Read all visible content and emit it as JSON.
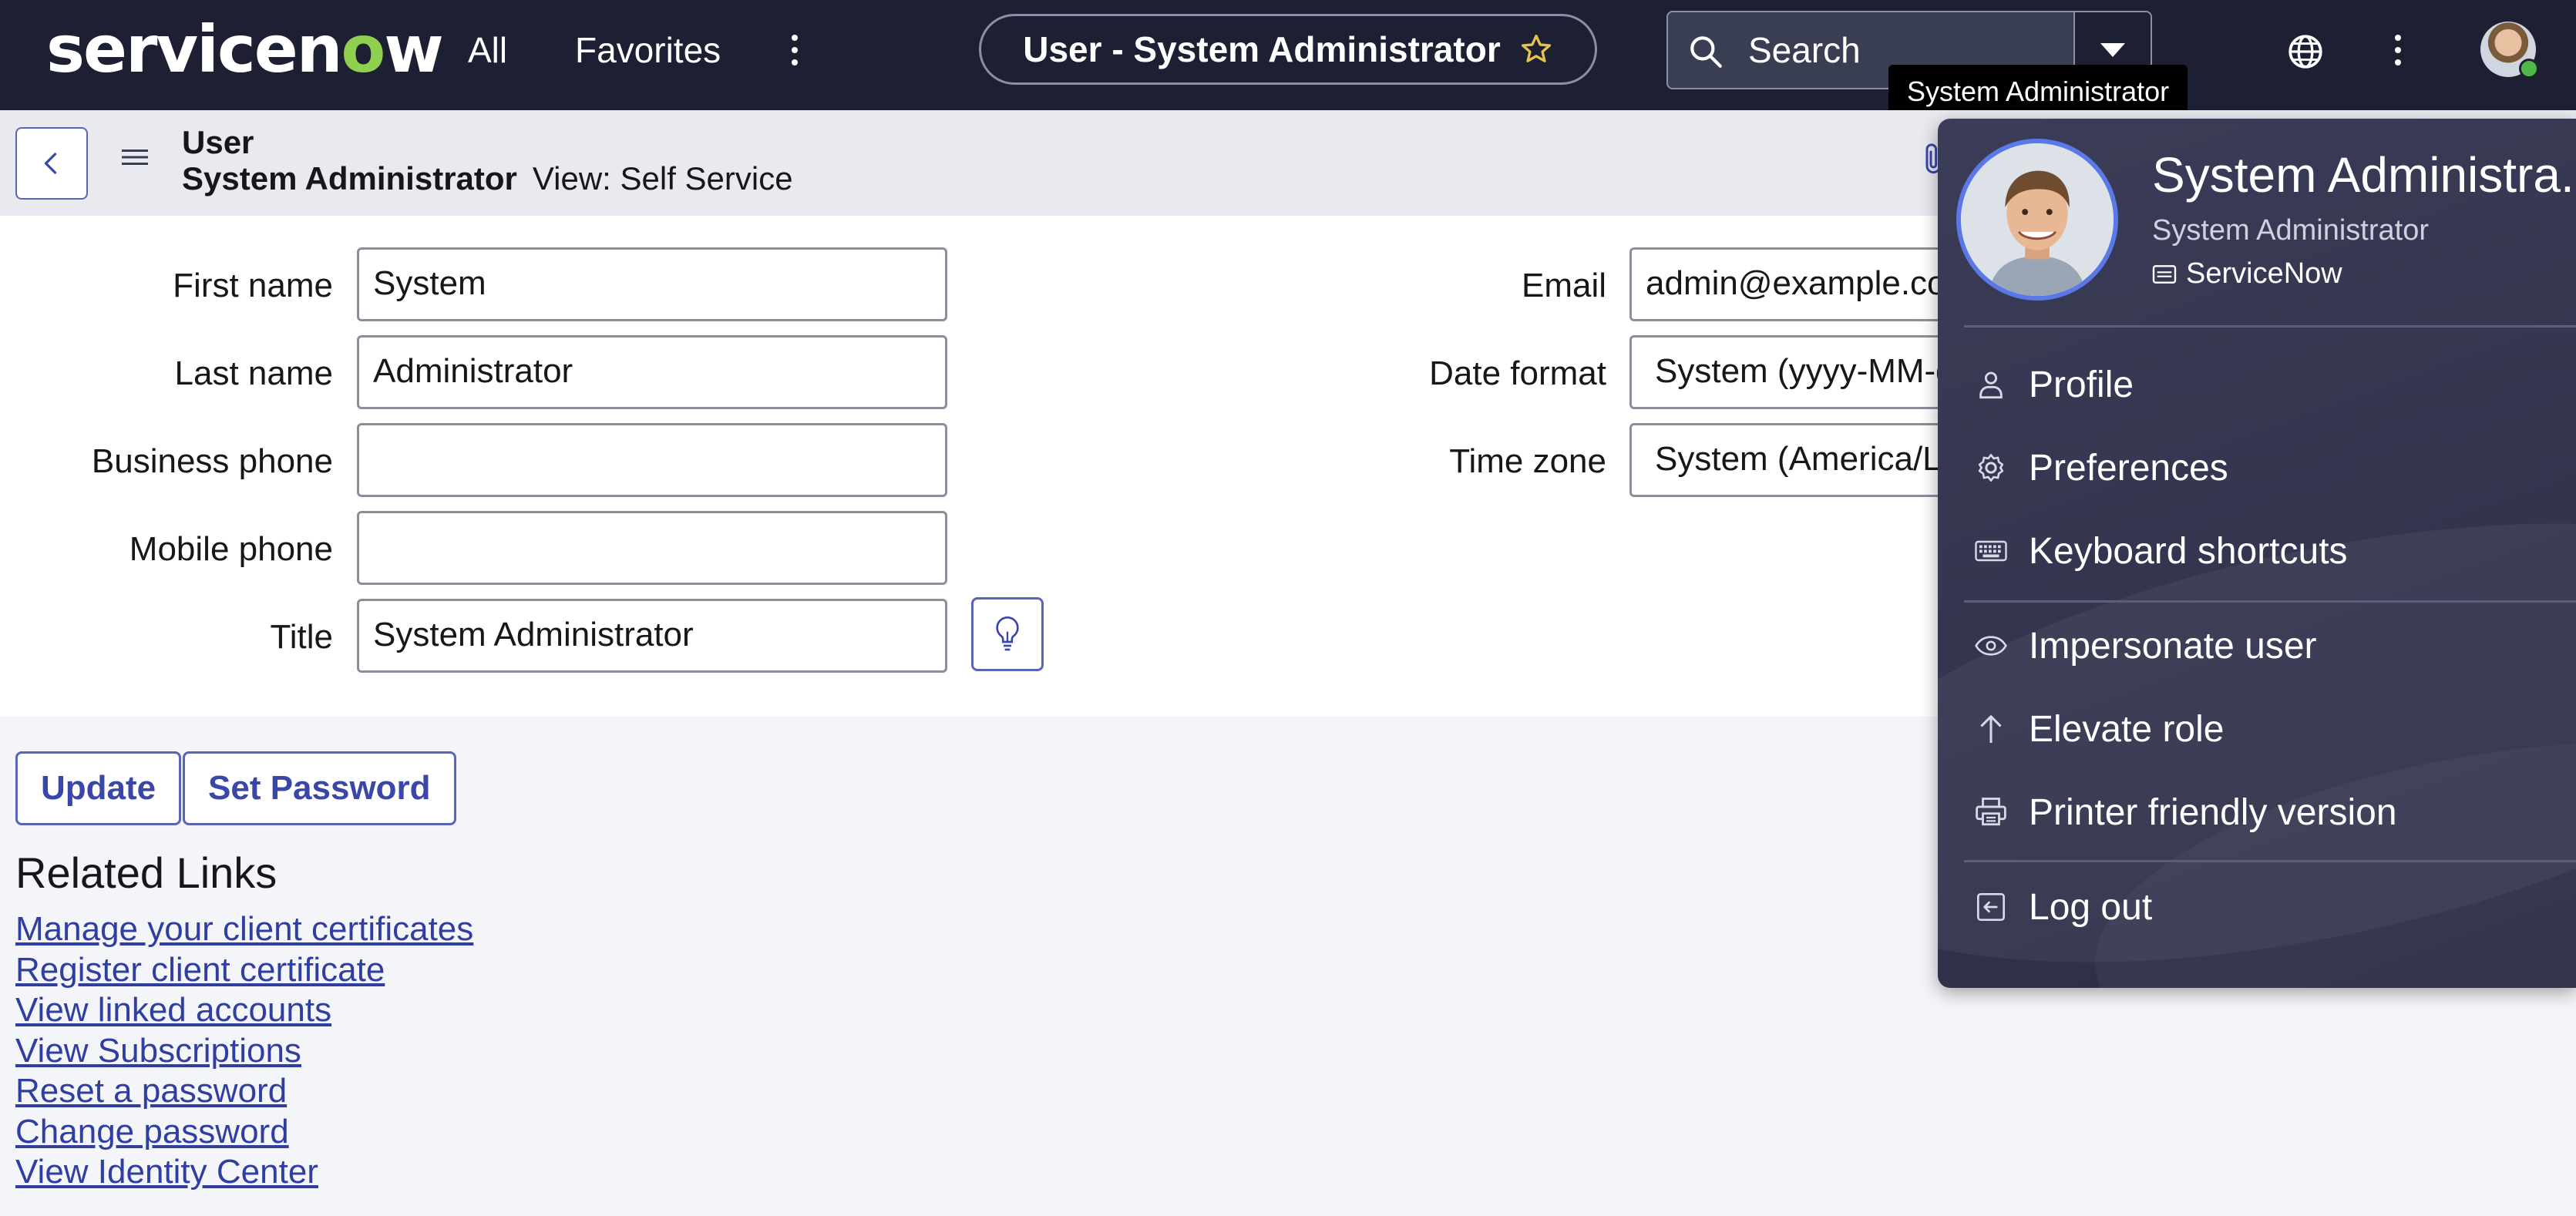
{
  "topnav": {
    "logo_prefix": "servicen",
    "logo_o": "o",
    "logo_suffix": "w",
    "all_label": "All",
    "favorites_label": "Favorites",
    "record_pill": "User - System Administrator",
    "search_placeholder": "Search",
    "tooltip": "System Administrator"
  },
  "header": {
    "table": "User",
    "record": "System Administrator",
    "view": "View: Self Service"
  },
  "form": {
    "first_name_label": "First name",
    "first_name": "System",
    "last_name_label": "Last name",
    "last_name": "Administrator",
    "business_phone_label": "Business phone",
    "business_phone": "",
    "mobile_phone_label": "Mobile phone",
    "mobile_phone": "",
    "title_label": "Title",
    "title": "System Administrator",
    "email_label": "Email",
    "email": "admin@example.com",
    "date_format_label": "Date format",
    "date_format": "System (yyyy-MM-dd)",
    "time_zone_label": "Time zone",
    "time_zone": "System (America/Los_Angeles)"
  },
  "actions": {
    "update": "Update",
    "set_password": "Set Password"
  },
  "related_links": {
    "title": "Related Links",
    "items": [
      "Manage your client certificates",
      "Register client certificate",
      "View linked accounts",
      "View Subscriptions",
      "Reset a password",
      "Change password",
      "View Identity Center"
    ]
  },
  "user_menu": {
    "name": "System Administra...",
    "role": "System Administrator",
    "org": "ServiceNow",
    "items": {
      "profile": "Profile",
      "preferences": "Preferences",
      "keyboard_shortcuts": "Keyboard shortcuts",
      "impersonate": "Impersonate user",
      "elevate": "Elevate role",
      "printer": "Printer friendly version",
      "logout": "Log out"
    }
  },
  "colors": {
    "nav_bg": "#1d2032",
    "accent": "#5b65b5",
    "link": "#2f3ea0",
    "status_online": "#4fb848"
  }
}
